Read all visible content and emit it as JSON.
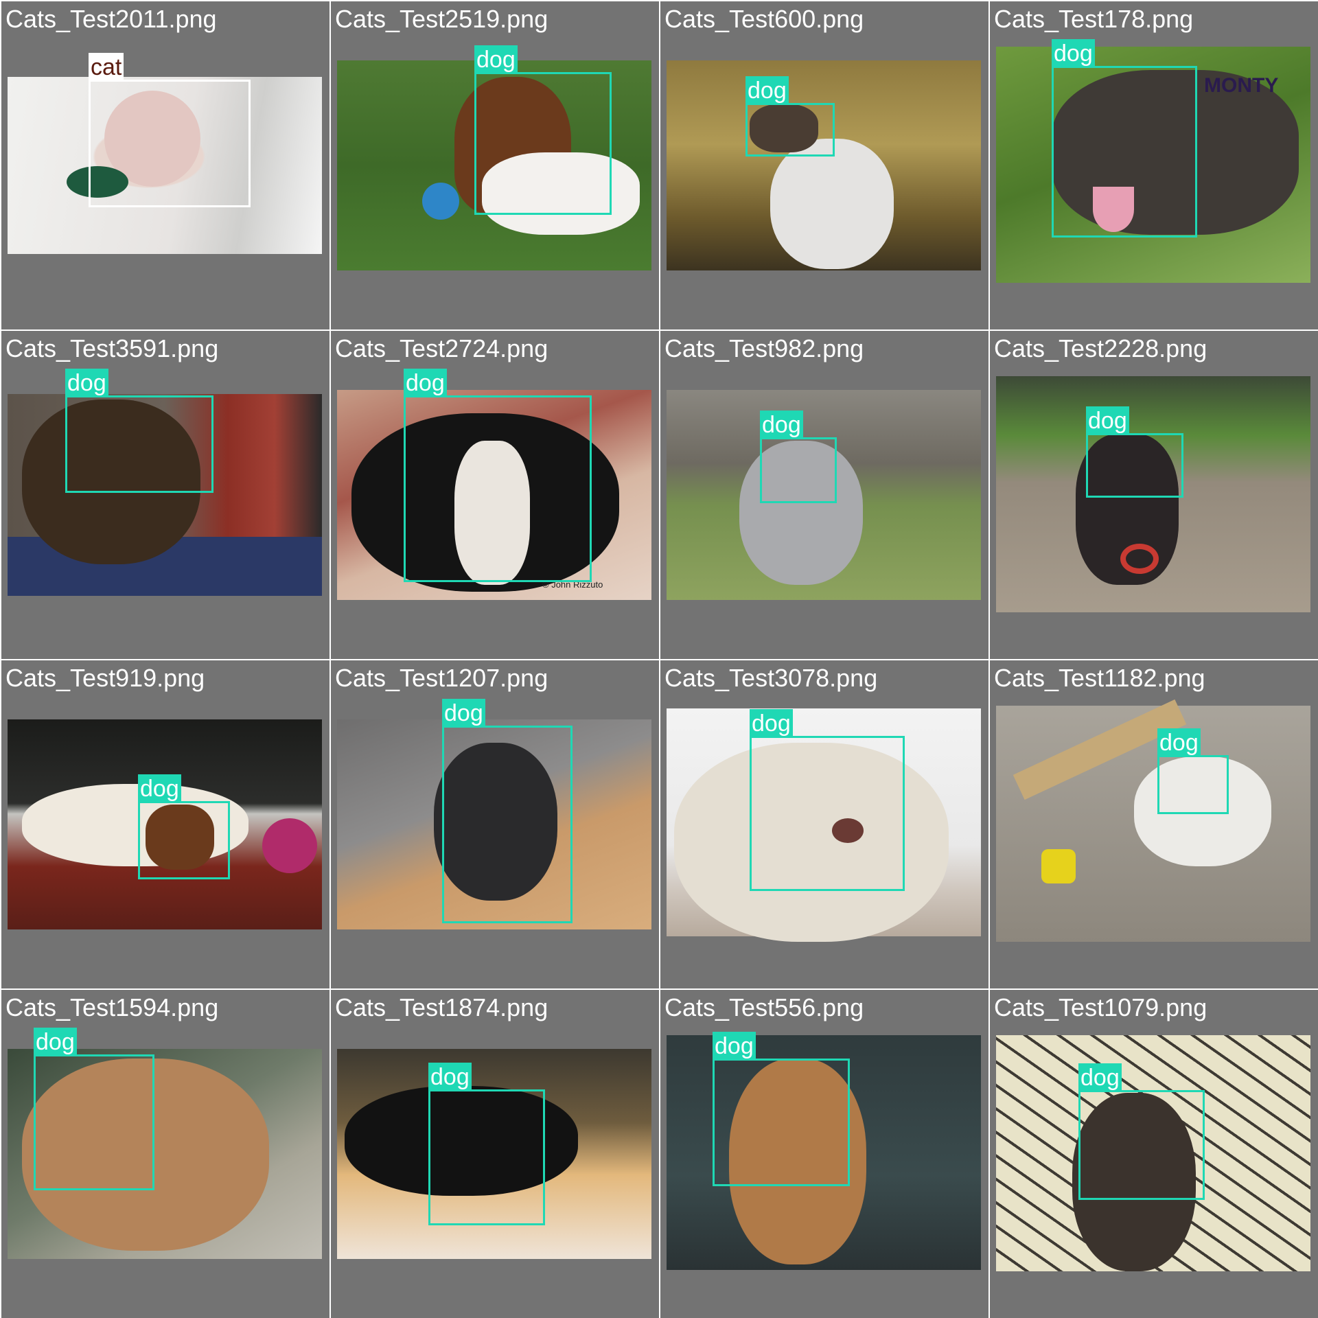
{
  "colors": {
    "panel_bg": "#737373",
    "dog_box": "#1fd8b4",
    "cat_box": "#ffffff",
    "cat_label_text": "#5a1b0f"
  },
  "cells": [
    {
      "filename": "Cats_Test2011.png",
      "label": "cat",
      "photo": "sphynx cat with feather toy"
    },
    {
      "filename": "Cats_Test2519.png",
      "label": "dog",
      "photo": "basset hound on grass with ball"
    },
    {
      "filename": "Cats_Test600.png",
      "label": "dog",
      "photo": "white dog in dry grass"
    },
    {
      "filename": "Cats_Test178.png",
      "label": "dog",
      "photo": "brindle staffy on grass",
      "watermark": "MONTY"
    },
    {
      "filename": "Cats_Test3591.png",
      "label": "dog",
      "photo": "yorkshire terrier puppy"
    },
    {
      "filename": "Cats_Test2724.png",
      "label": "dog",
      "photo": "basset hound lying down",
      "watermark": "© John Rizzuto"
    },
    {
      "filename": "Cats_Test982.png",
      "label": "dog",
      "photo": "grey fluffy dog in yard"
    },
    {
      "filename": "Cats_Test2228.png",
      "label": "dog",
      "photo": "black and white dog with ring"
    },
    {
      "filename": "Cats_Test919.png",
      "label": "dog",
      "photo": "saint bernard on porch"
    },
    {
      "filename": "Cats_Test1207.png",
      "label": "dog",
      "photo": "grey dog lying on floor"
    },
    {
      "filename": "Cats_Test3078.png",
      "label": "dog",
      "photo": "english setter portrait"
    },
    {
      "filename": "Cats_Test1182.png",
      "label": "dog",
      "photo": "white small dog with tape measure"
    },
    {
      "filename": "Cats_Test1594.png",
      "label": "dog",
      "photo": "pomeranian close-up"
    },
    {
      "filename": "Cats_Test1874.png",
      "label": "dog",
      "photo": "black scottish terrier sleeping"
    },
    {
      "filename": "Cats_Test556.png",
      "label": "dog",
      "photo": "chihuahua looking up"
    },
    {
      "filename": "Cats_Test1079.png",
      "label": "dog",
      "photo": "brindle puppy on tile floor"
    }
  ]
}
